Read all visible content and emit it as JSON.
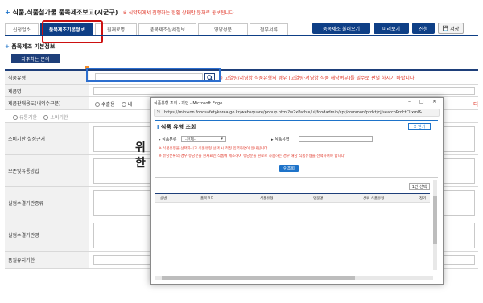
{
  "header": {
    "title": "식품,식품첨가물 품목제조보고(시군구)",
    "note": "※ 식약처에서 진행하는 현황 상태만 문자로 통보됩니다."
  },
  "tabs": [
    "신청업소",
    "품목제조기본정보",
    "원재료명",
    "품목제조상세정보",
    "영양성분",
    "첨부서류"
  ],
  "active_tab": 1,
  "toolbar": {
    "load_label": "품목제조 불러오기",
    "preview_label": "미리보기",
    "apply_label": "신청",
    "save_label": "저장"
  },
  "section": {
    "title": "품목제조 기본정보",
    "faq_button": "자주하는 문의"
  },
  "form": {
    "food_type_label": "식품유형",
    "food_type_note": "※ 고열량/저영양 식품유형의 경우 [고열량·저영양 식품 해당여부]를 필수로 판별 하시기 바랍니다.",
    "product_name_label": "제품명",
    "sales_label": "제품판매용도(내외수구분)",
    "radio_domestic": "수출용",
    "radio_partial": "내",
    "radio_a": "유통기한",
    "radio_b": "소비기한",
    "shelf_life_basis_label": "소비기한 설정근거",
    "storage_label": "보존및유통방법",
    "quality_period_label": "실험수결기관증류",
    "quality_label": "실험수결기관명",
    "quality_end_label": "품질유지기한",
    "red_mark": "다",
    "big_char_1": "위",
    "big_char_2": "한"
  },
  "popup": {
    "window_title": "식품유형 조회 - 개인 - Microsoft Edge",
    "url": "https://minwon.foodsafetykorea.go.kr/websquare/popup.html?w2xPath=/ui/foodadmin/cpt/common/prdct/cj/searchPrdctCl.xml&...",
    "heading": "식품 유형 조회",
    "close_label": "× 닫기",
    "filter_category_label": "▸ 식품분류",
    "filter_category_value": "-전체-",
    "filter_type_label": "▸ 식품유형",
    "note_1": "※ 식품유형을 선택하시고 식품유형 선택 시 적정 입력화면이 안내됩니다.",
    "note_2": "※ 유당분류의 경우 유당분을 원재료인 식품에 제조하여 유당분을 원료로 사용하는 경우 해당 식품유형을 선택하여야 합니다.",
    "search_button": "조회",
    "select_button": "1건 선택",
    "columns": [
      "순번",
      "품목코드",
      "식품유형",
      "영문명",
      "상위 식품유형",
      "정기"
    ]
  }
}
